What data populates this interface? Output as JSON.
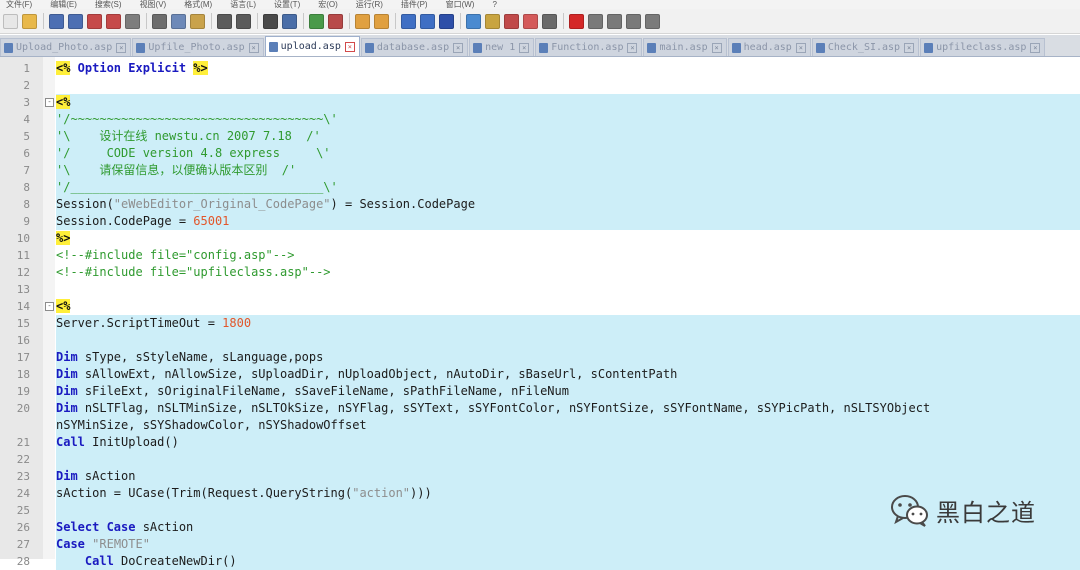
{
  "menubar": [
    "文件(F)",
    "编辑(E)",
    "搜索(S)",
    "视图(V)",
    "格式(M)",
    "语言(L)",
    "设置(T)",
    "宏(O)",
    "运行(R)",
    "插件(P)",
    "窗口(W)",
    "?"
  ],
  "toolbar_icons": [
    {
      "name": "new-file-icon",
      "color": "#e7e7e7"
    },
    {
      "name": "open-file-icon",
      "color": "#e8b84a"
    },
    {
      "name": "save-icon",
      "color": "#4d6fb3"
    },
    {
      "name": "save-all-icon",
      "color": "#4d6fb3"
    },
    {
      "name": "close-icon",
      "color": "#c64a4a"
    },
    {
      "name": "close-all-icon",
      "color": "#c64a4a"
    },
    {
      "name": "print-icon",
      "color": "#7d7d7d"
    },
    {
      "name": "cut-icon",
      "color": "#6d6d6d"
    },
    {
      "name": "copy-icon",
      "color": "#6d89b8"
    },
    {
      "name": "paste-icon",
      "color": "#c9a24b"
    },
    {
      "name": "undo-icon",
      "color": "#5b5b5b"
    },
    {
      "name": "redo-icon",
      "color": "#5b5b5b"
    },
    {
      "name": "find-icon",
      "color": "#4a4a4a"
    },
    {
      "name": "replace-icon",
      "color": "#4a6ea8"
    },
    {
      "name": "zoom-in-icon",
      "color": "#4a9a4a"
    },
    {
      "name": "zoom-out-icon",
      "color": "#b84a4a"
    },
    {
      "name": "sync-vertical-icon",
      "color": "#e0a040"
    },
    {
      "name": "sync-horizontal-icon",
      "color": "#e0a040"
    },
    {
      "name": "word-wrap-icon",
      "color": "#3f6fc4"
    },
    {
      "name": "show-all-chars-icon",
      "color": "#3f6fc4"
    },
    {
      "name": "indent-guide-icon",
      "color": "#2e4fa8"
    },
    {
      "name": "language-icon",
      "color": "#4a8ad0"
    },
    {
      "name": "doc-map-icon",
      "color": "#c8a440"
    },
    {
      "name": "function-list-icon",
      "color": "#c04a4a"
    },
    {
      "name": "folder-workspace-icon",
      "color": "#d45a5a"
    },
    {
      "name": "monitor-icon",
      "color": "#6a6a6a"
    },
    {
      "name": "record-macro-icon",
      "color": "#d42828"
    },
    {
      "name": "stop-macro-icon",
      "color": "#7a7a7a"
    },
    {
      "name": "play-macro-icon",
      "color": "#7a7a7a"
    },
    {
      "name": "play-multi-icon",
      "color": "#7a7a7a"
    },
    {
      "name": "save-macro-icon",
      "color": "#7a7a7a"
    }
  ],
  "tabs": [
    {
      "label": "Upload_Photo.asp",
      "active": false
    },
    {
      "label": "Upfile_Photo.asp",
      "active": false
    },
    {
      "label": "upload.asp",
      "active": true
    },
    {
      "label": "database.asp",
      "active": false
    },
    {
      "label": "new 1",
      "active": false
    },
    {
      "label": "Function.asp",
      "active": false
    },
    {
      "label": "main.asp",
      "active": false
    },
    {
      "label": "head.asp",
      "active": false
    },
    {
      "label": "Check_SI.asp",
      "active": false
    },
    {
      "label": "upfileclass.asp",
      "active": false
    }
  ],
  "editor": {
    "lines": [
      {
        "n": "1",
        "sel": false,
        "fold": "",
        "tokens": [
          {
            "t": "tag",
            "v": "<%"
          },
          {
            "t": "kw",
            "v": " Option Explicit "
          },
          {
            "t": "tag",
            "v": "%>"
          }
        ]
      },
      {
        "n": "2",
        "sel": false,
        "fold": "",
        "tokens": []
      },
      {
        "n": "3",
        "sel": true,
        "fold": "-",
        "tokens": [
          {
            "t": "tag",
            "v": "<%"
          }
        ]
      },
      {
        "n": "4",
        "sel": true,
        "fold": "",
        "tokens": [
          {
            "t": "cmt",
            "v": "'/~~~~~~~~~~~~~~~~~~~~~~~~~~~~~~~~~~~\\'"
          }
        ]
      },
      {
        "n": "5",
        "sel": true,
        "fold": "",
        "tokens": [
          {
            "t": "cmt",
            "v": "'\\    设计在线 newstu.cn 2007 7.18  /'"
          }
        ]
      },
      {
        "n": "6",
        "sel": true,
        "fold": "",
        "tokens": [
          {
            "t": "cmt",
            "v": "'/     CODE version 4.8 express     \\'"
          }
        ]
      },
      {
        "n": "7",
        "sel": true,
        "fold": "",
        "tokens": [
          {
            "t": "cmt",
            "v": "'\\    请保留信息，以便确认版本区别  /'"
          }
        ]
      },
      {
        "n": "8",
        "sel": true,
        "fold": "",
        "tokens": [
          {
            "t": "cmt",
            "v": "'/___________________________________\\'"
          }
        ]
      },
      {
        "n": "8",
        "sel": true,
        "fold": "",
        "tokens": [
          {
            "t": "plain",
            "v": "Session("
          },
          {
            "t": "str",
            "v": "\"eWebEditor_Original_CodePage\""
          },
          {
            "t": "plain",
            "v": ") = Session.CodePage"
          }
        ]
      },
      {
        "n": "9",
        "sel": true,
        "fold": "",
        "tokens": [
          {
            "t": "plain",
            "v": "Session.CodePage = "
          },
          {
            "t": "num",
            "v": "65001"
          }
        ]
      },
      {
        "n": "10",
        "sel": false,
        "fold": "",
        "tokens": [
          {
            "t": "tag",
            "v": "%>"
          }
        ]
      },
      {
        "n": "11",
        "sel": false,
        "fold": "",
        "tokens": [
          {
            "t": "cmt",
            "v": "<!--#include file=\"config.asp\"-->"
          }
        ]
      },
      {
        "n": "12",
        "sel": false,
        "fold": "",
        "tokens": [
          {
            "t": "cmt",
            "v": "<!--#include file=\"upfileclass.asp\"-->"
          }
        ]
      },
      {
        "n": "13",
        "sel": false,
        "fold": "",
        "tokens": []
      },
      {
        "n": "14",
        "sel": false,
        "fold": "-",
        "tokens": [
          {
            "t": "tag",
            "v": "<%"
          }
        ]
      },
      {
        "n": "15",
        "sel": true,
        "fold": "",
        "tokens": [
          {
            "t": "plain",
            "v": "Server.ScriptTimeOut = "
          },
          {
            "t": "num",
            "v": "1800"
          }
        ]
      },
      {
        "n": "16",
        "sel": true,
        "fold": "",
        "tokens": []
      },
      {
        "n": "17",
        "sel": true,
        "fold": "",
        "tokens": [
          {
            "t": "kw",
            "v": "Dim"
          },
          {
            "t": "plain",
            "v": " sType, sStyleName, sLanguage,pops"
          }
        ]
      },
      {
        "n": "18",
        "sel": true,
        "fold": "",
        "tokens": [
          {
            "t": "kw",
            "v": "Dim"
          },
          {
            "t": "plain",
            "v": " sAllowExt, nAllowSize, sUploadDir, nUploadObject, nAutoDir, sBaseUrl, sContentPath"
          }
        ]
      },
      {
        "n": "19",
        "sel": true,
        "fold": "",
        "tokens": [
          {
            "t": "kw",
            "v": "Dim"
          },
          {
            "t": "plain",
            "v": " sFileExt, sOriginalFileName, sSaveFileName, sPathFileName, nFileNum"
          }
        ]
      },
      {
        "n": "20",
        "sel": true,
        "fold": "",
        "tokens": [
          {
            "t": "kw",
            "v": "Dim"
          },
          {
            "t": "plain",
            "v": " nSLTFlag, nSLTMinSize, nSLTOkSize, nSYFlag, sSYText, sSYFontColor, nSYFontSize, sSYFontName, sSYPicPath, nSLTSYObject"
          }
        ]
      },
      {
        "n": "",
        "sel": true,
        "fold": "",
        "tokens": [
          {
            "t": "plain",
            "v": "nSYMinSize, sSYShadowColor, nSYShadowOffset"
          }
        ]
      },
      {
        "n": "21",
        "sel": true,
        "fold": "",
        "tokens": [
          {
            "t": "kw",
            "v": "Call"
          },
          {
            "t": "plain",
            "v": " InitUpload()"
          }
        ]
      },
      {
        "n": "22",
        "sel": true,
        "fold": "",
        "tokens": []
      },
      {
        "n": "23",
        "sel": true,
        "fold": "",
        "tokens": [
          {
            "t": "kw",
            "v": "Dim"
          },
          {
            "t": "plain",
            "v": " sAction"
          }
        ]
      },
      {
        "n": "24",
        "sel": true,
        "fold": "",
        "tokens": [
          {
            "t": "plain",
            "v": "sAction = UCase(Trim(Request.QueryString("
          },
          {
            "t": "str",
            "v": "\"action\""
          },
          {
            "t": "plain",
            "v": ")))"
          }
        ]
      },
      {
        "n": "25",
        "sel": true,
        "fold": "",
        "tokens": []
      },
      {
        "n": "26",
        "sel": true,
        "fold": "",
        "tokens": [
          {
            "t": "kw",
            "v": "Select Case"
          },
          {
            "t": "plain",
            "v": " sAction"
          }
        ]
      },
      {
        "n": "27",
        "sel": true,
        "fold": "",
        "tokens": [
          {
            "t": "kw",
            "v": "Case"
          },
          {
            "t": "plain",
            "v": " "
          },
          {
            "t": "str",
            "v": "\"REMOTE\""
          }
        ]
      },
      {
        "n": "28",
        "sel": true,
        "fold": "",
        "tokens": [
          {
            "t": "plain",
            "v": "    "
          },
          {
            "t": "kw",
            "v": "Call"
          },
          {
            "t": "plain",
            "v": " DoCreateNewDir()"
          }
        ]
      }
    ]
  },
  "watermark": {
    "text": "黑白之道"
  }
}
